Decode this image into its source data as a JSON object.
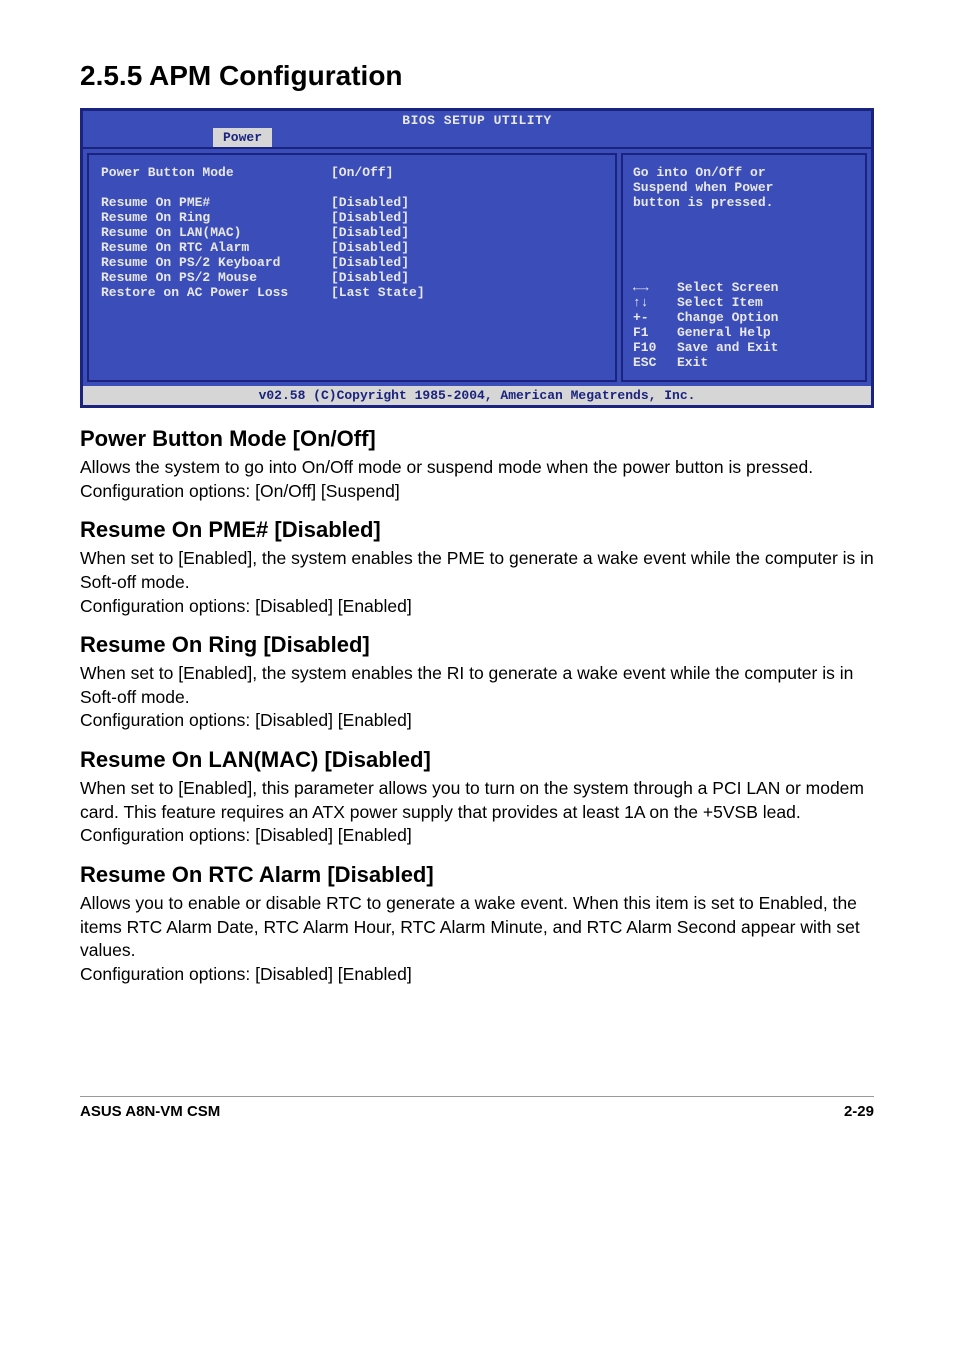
{
  "heading_1": "2.5.5  APM Configuration",
  "bios": {
    "title": "BIOS SETUP UTILITY",
    "tab": "Power",
    "rows": [
      {
        "label": "Power Button Mode",
        "value": "[On/Off]"
      },
      {
        "label": "",
        "value": ""
      },
      {
        "label": "Resume On PME#",
        "value": "[Disabled]"
      },
      {
        "label": "Resume On Ring",
        "value": "[Disabled]"
      },
      {
        "label": "Resume On LAN(MAC)",
        "value": "[Disabled]"
      },
      {
        "label": "Resume On RTC Alarm",
        "value": "[Disabled]"
      },
      {
        "label": "Resume On PS/2 Keyboard",
        "value": "[Disabled]"
      },
      {
        "label": "Resume On PS/2 Mouse",
        "value": "[Disabled]"
      },
      {
        "label": "Restore on AC Power Loss",
        "value": "[Last State]"
      }
    ],
    "help1": "Go into On/Off or",
    "help2": "Suspend when Power",
    "help3": "button is pressed.",
    "k1a": "←→",
    "k1b": "Select Screen",
    "k2a": "↑↓",
    "k2b": "Select Item",
    "k3a": "+-",
    "k3b": "Change Option",
    "k4a": "F1",
    "k4b": "General Help",
    "k5a": "F10",
    "k5b": "Save and Exit",
    "k6a": "ESC",
    "k6b": "Exit",
    "footer": "v02.58 (C)Copyright 1985-2004, American Megatrends, Inc."
  },
  "sections": [
    {
      "heading": "Power Button Mode [On/Off]",
      "body": "Allows the system to go into On/Off mode or suspend mode when the power  button is pressed. Configuration options: [On/Off] [Suspend]"
    },
    {
      "heading": "Resume On PME# [Disabled]",
      "body": "When set to [Enabled], the system enables the PME to generate a wake event while the computer is in Soft-off mode.\nConfiguration options: [Disabled] [Enabled]"
    },
    {
      "heading": "Resume On Ring [Disabled]",
      "body": "When set to [Enabled], the system enables the RI to generate a wake event while the computer is in Soft-off mode.\nConfiguration options: [Disabled] [Enabled]"
    },
    {
      "heading": "Resume On LAN(MAC) [Disabled]",
      "body": "When set to [Enabled], this parameter allows you to turn on the system through a PCI LAN or modem card. This feature requires an ATX power supply that provides at least 1A on the +5VSB lead.\nConfiguration options: [Disabled] [Enabled]"
    },
    {
      "heading": "Resume On RTC Alarm [Disabled]",
      "body": "Allows you to enable or disable RTC to generate a wake event. When this item is set to Enabled, the items RTC Alarm Date, RTC Alarm Hour, RTC Alarm Minute, and RTC Alarm Second appear with set values.\nConfiguration options: [Disabled] [Enabled]"
    }
  ],
  "page_footer_left": "ASUS A8N-VM CSM",
  "page_footer_right": "2-29"
}
